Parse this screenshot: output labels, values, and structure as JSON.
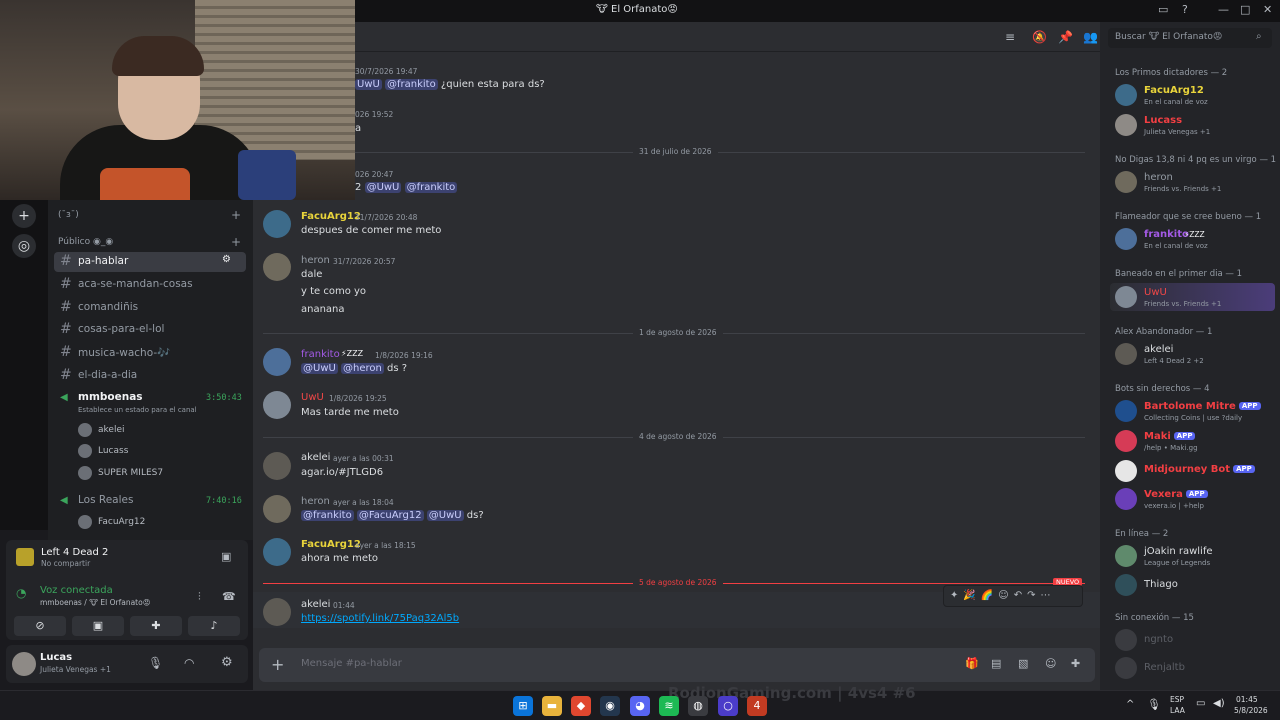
{
  "window": {
    "title": "🐮 El Orfanato😡"
  },
  "header": {
    "search_placeholder": "Buscar 🐮 El Orfanato😡"
  },
  "sidebar": {
    "top_item": "(¯з¯)",
    "category": "Público ◉_◉",
    "channels": [
      {
        "name": "pa-hablar",
        "selected": true
      },
      {
        "name": "aca-se-mandan-cosas"
      },
      {
        "name": "comandiñis"
      },
      {
        "name": "cosas-para-el-lol"
      },
      {
        "name": "musica-wacho-🎶"
      },
      {
        "name": "el-dia-a-dia"
      }
    ],
    "voice1": {
      "name": "mmboenas",
      "timer": "3:50:43",
      "status": "Establece un estado para el canal",
      "users": [
        "akelei",
        "Lucass",
        "SUPER MILES7"
      ]
    },
    "voice2": {
      "name": "Los Reales",
      "timer": "7:40:16",
      "users": [
        "FacuArg12"
      ]
    }
  },
  "activity": {
    "game": "Left 4 Dead 2",
    "sub": "No compartir"
  },
  "voice_status": {
    "title": "Voz conectada",
    "sub": "mmboenas / 🐮 El Orfanato😡"
  },
  "user_panel": {
    "name": "Lucas",
    "status": "Julieta Venegas +1"
  },
  "messages": [
    {
      "ts": "30/7/2026 19:47",
      "mentions": [
        "UwU",
        "@frankito"
      ],
      "text": "¿quien esta para ds?"
    },
    {
      "ts": "026 19:52",
      "text": "a"
    },
    {
      "divider": "31 de julio de 2026"
    },
    {
      "ts": "026 20:47",
      "mentions": [
        "2",
        "@UwU",
        "@frankito"
      ]
    },
    {
      "author": "FacuArg12",
      "ts": "31/7/2026 20:48",
      "text": "despues de comer me meto",
      "color": "#e9d43b"
    },
    {
      "author": "heron",
      "ts": "31/7/2026 20:57",
      "lines": [
        "dale",
        "y te como yo",
        "ananana"
      ],
      "color": "#949ba4"
    },
    {
      "divider": "1 de agosto de 2026"
    },
    {
      "author": "frankito",
      "badge": "⚡ZZZ",
      "ts": "1/8/2026 19:16",
      "mentions": [
        "@UwU",
        "@heron"
      ],
      "text": "ds ?",
      "color": "#a35ae6"
    },
    {
      "author": "UwU",
      "ts": "1/8/2026 19:25",
      "text": "Mas tarde me meto",
      "color": "#f04747"
    },
    {
      "divider": "4 de agosto de 2026"
    },
    {
      "author": "akelei",
      "ts": "ayer a las 00:31",
      "text": "agar.io/#JTLGD6",
      "color": "#dbdee1"
    },
    {
      "author": "heron",
      "ts": "ayer a las 18:04",
      "mentions": [
        "@frankito",
        "@FacuArg12",
        "@UwU"
      ],
      "text": "ds?",
      "color": "#949ba4"
    },
    {
      "author": "FacuArg12",
      "ts": "ayer a las 18:15",
      "text": "ahora me meto",
      "color": "#e9d43b"
    },
    {
      "divider": "5 de agosto de 2026",
      "new_badge": "NUEVO"
    },
    {
      "author": "akelei",
      "ts": "01:44",
      "link": "https://spotify.link/75Paq32Al5b",
      "color": "#dbdee1"
    }
  ],
  "composer": {
    "placeholder": "Mensaje #pa-hablar"
  },
  "members": {
    "groups": [
      {
        "title": "Los Primos dictadores — 2",
        "items": [
          {
            "name": "FacuArg12",
            "sub": "En el canal de voz",
            "color": "#e9d43b"
          },
          {
            "name": "Lucass",
            "sub": "Julieta Venegas +1",
            "color": "#f23f43"
          }
        ]
      },
      {
        "title": "No Digas 13,8 ni 4 pq es un virgo — 1",
        "items": [
          {
            "name": "heron",
            "sub": "Friends vs. Friends +1",
            "color": "#949ba4"
          }
        ]
      },
      {
        "title": "Flameador que se cree bueno — 1",
        "items": [
          {
            "name": "frankito",
            "badge": "⚡ZZZ",
            "sub": "En el canal de voz",
            "color": "#a35ae6"
          }
        ]
      },
      {
        "title": "Baneado en el primer dia — 1",
        "items": [
          {
            "name": "UwU",
            "sub": "Friends vs. Friends +1",
            "color": "#f04747"
          }
        ]
      },
      {
        "title": "Alex Abandonador — 1",
        "items": [
          {
            "name": "akelei",
            "sub": "Left 4 Dead 2 +2",
            "color": "#dbdee1"
          }
        ]
      },
      {
        "title": "Bots sin derechos — 4",
        "items": [
          {
            "name": "Bartolome Mitre",
            "app": "APP",
            "sub": "Collecting Coins | use ?daily",
            "color": "#f23f43"
          },
          {
            "name": "Maki",
            "app": "APP",
            "sub": "/help • Maki.gg",
            "color": "#f23f43"
          },
          {
            "name": "Midjourney Bot",
            "app": "APP",
            "sub": "",
            "color": "#f23f43"
          },
          {
            "name": "Vexera",
            "app": "APP",
            "sub": "vexera.io | +help",
            "color": "#f23f43"
          }
        ]
      },
      {
        "title": "En línea — 2",
        "items": [
          {
            "name": "jOakin rawlife",
            "sub": "League of Legends",
            "color": "#dbdee1"
          },
          {
            "name": "Thiago",
            "sub": "",
            "color": "#dbdee1"
          }
        ]
      },
      {
        "title": "Sin conexión — 15",
        "items": [
          {
            "name": "ngnto",
            "sub": "",
            "color": "#5c5f66"
          },
          {
            "name": "Renjaltb",
            "sub": "",
            "color": "#5c5f66"
          }
        ]
      }
    ]
  },
  "taskbar": {
    "lang1": "ESP",
    "lang2": "LAA",
    "time": "01:45",
    "date": "5/8/2026",
    "stream_overlay": "RodionGaming.com | 4vs4 #6"
  }
}
